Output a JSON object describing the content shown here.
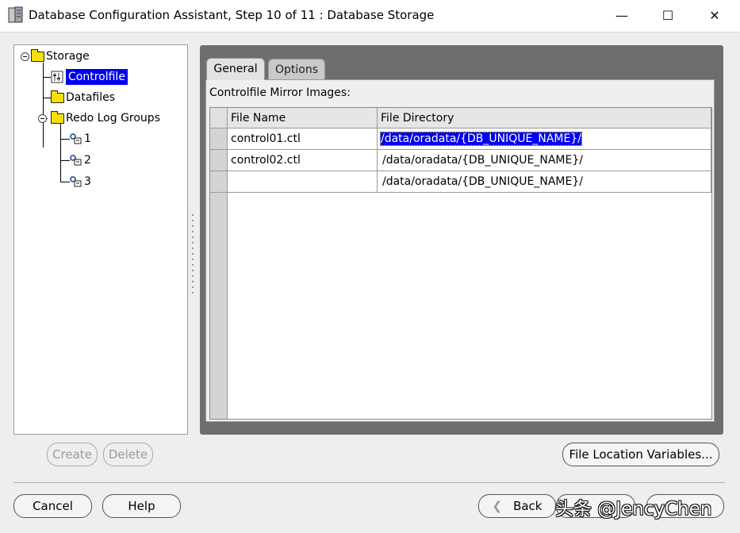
{
  "window": {
    "title": "Database Configuration Assistant, Step 10 of 11 : Database Storage",
    "min_glyph": "—",
    "max_glyph": "☐",
    "close_glyph": "✕"
  },
  "tree": {
    "root": "Storage",
    "items": [
      {
        "label": "Controlfile",
        "selected": true
      },
      {
        "label": "Datafiles"
      },
      {
        "label": "Redo Log Groups"
      }
    ],
    "redo_groups": [
      "1",
      "2",
      "3"
    ]
  },
  "tabs": [
    {
      "label": "General",
      "active": true
    },
    {
      "label": "Options"
    }
  ],
  "general": {
    "mirror_label": "Controlfile Mirror Images:",
    "columns": [
      "File Name",
      "File Directory"
    ],
    "rows": [
      {
        "file_name": "control01.ctl",
        "directory": "/data/oradata/{DB_UNIQUE_NAME}/"
      },
      {
        "file_name": "control02.ctl",
        "directory": "/data/oradata/{DB_UNIQUE_NAME}/"
      },
      {
        "file_name": "",
        "directory": "/data/oradata/{DB_UNIQUE_NAME}/"
      }
    ]
  },
  "buttons": {
    "create": "Create",
    "delete": "Delete",
    "file_location_variables": "File Location Variables...",
    "cancel": "Cancel",
    "help": "Help",
    "back": "Back",
    "back_icon": "chevron-left"
  },
  "watermark": "头条 @JencyChen",
  "colors": {
    "selection": "#0000ee",
    "folder": "#f8e000",
    "frame": "#6e6e6e"
  }
}
